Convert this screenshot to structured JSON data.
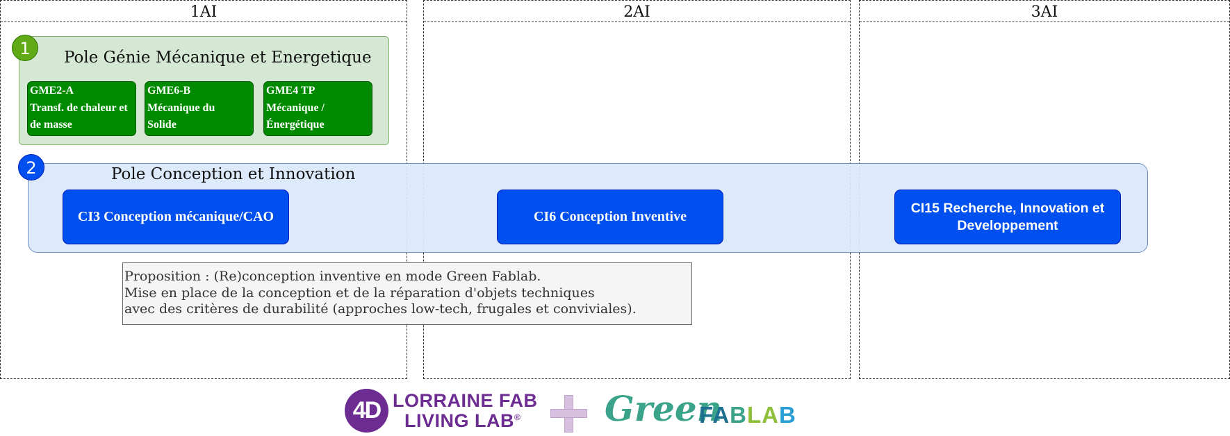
{
  "columns": [
    {
      "title": "1AI"
    },
    {
      "title": "2AI"
    },
    {
      "title": "3AI"
    }
  ],
  "pole1": {
    "number": "1",
    "title": "Pole Génie Mécanique et Energetique",
    "courses": [
      {
        "lines": [
          "GME2-A",
          "Transf. de chaleur et",
          "de masse"
        ]
      },
      {
        "lines": [
          "GME6-B",
          "Mécanique du",
          "Solide"
        ]
      },
      {
        "lines": [
          "GME4 TP",
          "Mécanique  /",
          "Énergétique"
        ]
      }
    ]
  },
  "pole2": {
    "number": "2",
    "title": "Pole Conception et Innovation",
    "courses": [
      {
        "label": "CI3 Conception mécanique/CAO"
      },
      {
        "label": "CI6 Conception Inventive"
      },
      {
        "label": "CI15 Recherche, Innovation et Developpement"
      }
    ]
  },
  "proposal": {
    "lines": [
      "Proposition : (Re)conception inventive en mode Green Fablab.",
      "Mise en place de la conception et de la réparation d'objets techniques",
      "avec des critères de durabilité (approches low-tech, frugales et conviviales)."
    ]
  },
  "logos": {
    "lorraine_mark": "4D",
    "lorraine_line1": "LORRAINE FAB",
    "lorraine_line2": "LIVING LAB",
    "lorraine_reg": "®",
    "plus_icon": "plus-icon",
    "green": "Green",
    "fablab_parts": [
      "FA",
      "B",
      "LA",
      "B"
    ]
  },
  "colors": {
    "pole1_fill": "#d5e8d4",
    "pole1_course": "#008a00",
    "pole2_fill": "#dae8fc",
    "pole2_course": "#0050ef",
    "badge1": "#60a917",
    "badge2": "#0050ef",
    "lorraine_purple": "#6d2c91",
    "green_teal": "#3aa38a"
  }
}
